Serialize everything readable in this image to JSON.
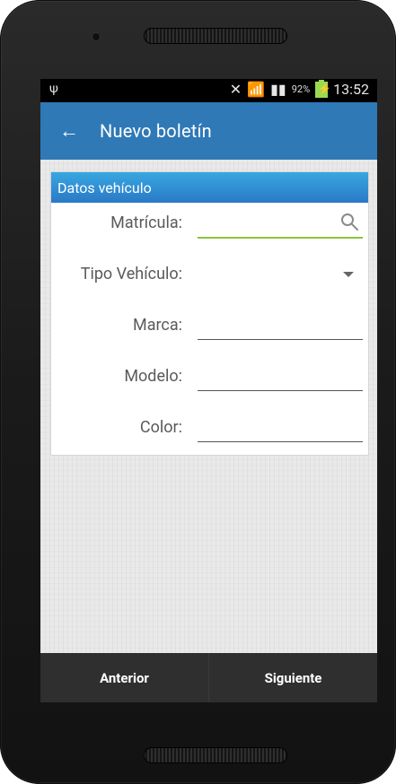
{
  "status_bar": {
    "usb_icon": "usb-icon",
    "muted_icon": "vibrate-off-icon",
    "wifi_icon": "wifi-icon",
    "signal_icon": "signal-icon",
    "battery_percent": "92%",
    "time": "13:52"
  },
  "app_bar": {
    "title": "Nuevo boletín",
    "back_icon": "arrow-left-icon"
  },
  "section": {
    "title": "Datos vehículo"
  },
  "form": {
    "fields": [
      {
        "label": "Matrícula:",
        "value": ""
      },
      {
        "label": "Tipo Vehículo:",
        "value": ""
      },
      {
        "label": "Marca:",
        "value": ""
      },
      {
        "label": "Modelo:",
        "value": ""
      },
      {
        "label": "Color:",
        "value": ""
      }
    ],
    "search_icon": "search-icon",
    "dropdown_icon": "chevron-down-icon"
  },
  "bottom_nav": {
    "prev_label": "Anterior",
    "next_label": "Siguiente"
  },
  "colors": {
    "app_bar": "#2f79b7",
    "section_header": "#2a79c6",
    "active_underline": "#89c43a",
    "bottom_bar": "#2f2f2f"
  }
}
